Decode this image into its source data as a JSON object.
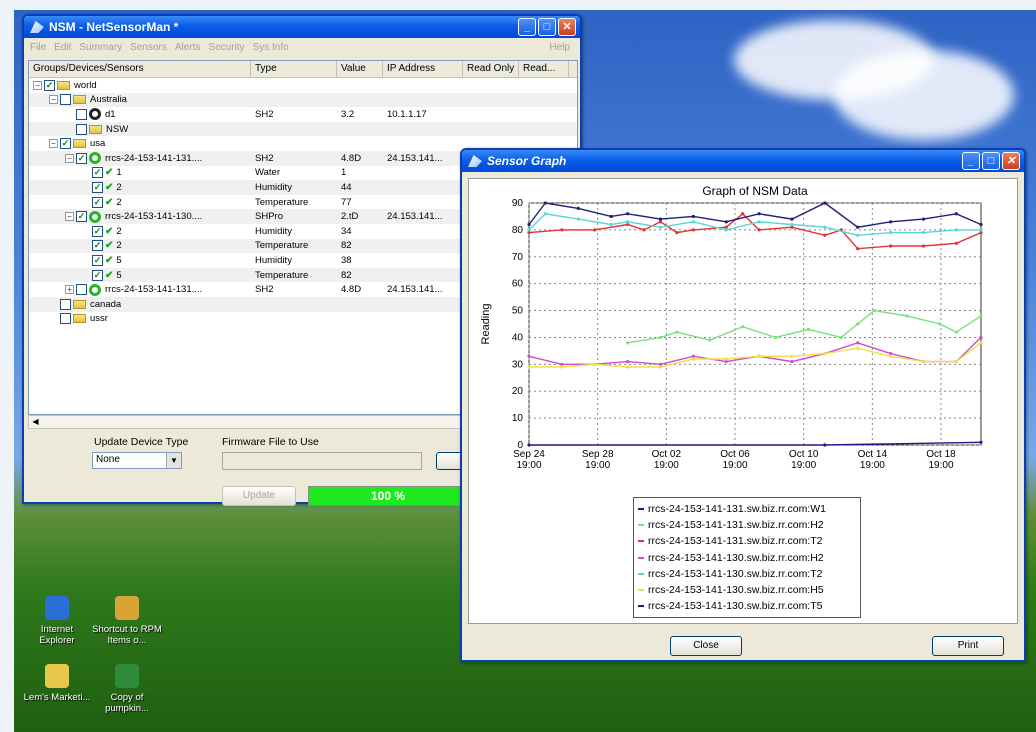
{
  "nsm_window": {
    "title": "NSM - NetSensorMan *",
    "menu": [
      "File",
      "Edit",
      "Summary",
      "Sensors",
      "Alerts",
      "Security",
      "Sys Info"
    ],
    "help": "Help",
    "columns": [
      "Groups/Devices/Sensors",
      "Type",
      "Value",
      "IP Address",
      "Read Only",
      "Read..."
    ],
    "tree": [
      {
        "level": 0,
        "expander": "−",
        "checked": true,
        "icon": "folder-icon",
        "name": "world",
        "type": "",
        "value": "",
        "ip": ""
      },
      {
        "level": 1,
        "expander": "−",
        "checked": false,
        "icon": "folder-icon",
        "name": "Australia",
        "type": "",
        "value": "",
        "ip": ""
      },
      {
        "level": 2,
        "expander": "",
        "checked": false,
        "icon": "device-offline-icon",
        "name": "d1",
        "type": "SH2",
        "value": "3.2",
        "ip": "10.1.1.17"
      },
      {
        "level": 2,
        "expander": "",
        "checked": false,
        "icon": "folder-icon",
        "name": "NSW",
        "type": "",
        "value": "",
        "ip": ""
      },
      {
        "level": 1,
        "expander": "−",
        "checked": true,
        "icon": "folder-icon",
        "name": "usa",
        "type": "",
        "value": "",
        "ip": ""
      },
      {
        "level": 2,
        "expander": "−",
        "checked": true,
        "icon": "device-online-icon",
        "name": "rrcs-24-153-141-131....",
        "type": "SH2",
        "value": "4.8D",
        "ip": "24.153.141..."
      },
      {
        "level": 3,
        "expander": "",
        "checked": true,
        "icon": "tick-icon",
        "name": "1",
        "type": "Water",
        "value": "1",
        "ip": ""
      },
      {
        "level": 3,
        "expander": "",
        "checked": true,
        "icon": "tick-icon",
        "name": "2",
        "type": "Humidity",
        "value": "44",
        "ip": ""
      },
      {
        "level": 3,
        "expander": "",
        "checked": true,
        "icon": "tick-icon",
        "name": "2",
        "type": "Temperature",
        "value": "77",
        "ip": ""
      },
      {
        "level": 2,
        "expander": "−",
        "checked": true,
        "icon": "device-online-icon",
        "name": "rrcs-24-153-141-130....",
        "type": "SHPro",
        "value": "2.tD",
        "ip": "24.153.141..."
      },
      {
        "level": 3,
        "expander": "",
        "checked": true,
        "icon": "tick-icon",
        "name": "2",
        "type": "Humidity",
        "value": "34",
        "ip": ""
      },
      {
        "level": 3,
        "expander": "",
        "checked": true,
        "icon": "tick-icon",
        "name": "2",
        "type": "Temperature",
        "value": "82",
        "ip": ""
      },
      {
        "level": 3,
        "expander": "",
        "checked": true,
        "icon": "tick-icon",
        "name": "5",
        "type": "Humidity",
        "value": "38",
        "ip": ""
      },
      {
        "level": 3,
        "expander": "",
        "checked": true,
        "icon": "tick-icon",
        "name": "5",
        "type": "Temperature",
        "value": "82",
        "ip": ""
      },
      {
        "level": 2,
        "expander": "+",
        "checked": false,
        "icon": "device-online-icon",
        "name": "rrcs-24-153-141-131....",
        "type": "SH2",
        "value": "4.8D",
        "ip": "24.153.141..."
      },
      {
        "level": 1,
        "expander": "",
        "checked": false,
        "icon": "folder-icon",
        "name": "canada",
        "type": "",
        "value": "",
        "ip": ""
      },
      {
        "level": 1,
        "expander": "",
        "checked": false,
        "icon": "folder-icon",
        "name": "ussr",
        "type": "",
        "value": "",
        "ip": ""
      }
    ],
    "update_device_type_label": "Update Device Type",
    "firmware_label": "Firmware File to Use",
    "device_type_value": "None",
    "update_button": "Update",
    "progress_text": "100 %",
    "progress_fraction": 1.0
  },
  "graph_window": {
    "title": "Sensor Graph",
    "close_button": "Close",
    "print_button": "Print"
  },
  "desktop_icons": [
    {
      "label": "Internet Explorer",
      "icon": "ie-icon",
      "color": "#2a6fd6"
    },
    {
      "label": "Shortcut to RPM Items o...",
      "icon": "shortcut-icon",
      "color": "#d8a43a"
    },
    {
      "label": "Lem's Marketi...",
      "icon": "folder-icon",
      "color": "#e8c84a"
    },
    {
      "label": "Copy of pumpkin...",
      "icon": "excel-icon",
      "color": "#2f8a3a"
    }
  ],
  "chart_data": {
    "type": "line",
    "title": "Graph of NSM Data",
    "xlabel": "",
    "ylabel": "Reading",
    "ylim": [
      0,
      90
    ],
    "yticks": [
      0,
      10,
      20,
      30,
      40,
      50,
      60,
      70,
      80,
      90
    ],
    "xticks": [
      "Sep 24\n19:00",
      "Sep 28\n19:00",
      "Oct 02\n19:00",
      "Oct 06\n19:00",
      "Oct 10\n19:00",
      "Oct 14\n19:00",
      "Oct 18\n19:00"
    ],
    "xlim_days": [
      0,
      27.5
    ],
    "grid": true,
    "legend": "bottom",
    "series": [
      {
        "name": "rrcs-24-153-141-131.sw.biz.rr.com:W1",
        "color": "#1a1a8c",
        "x": [
          0,
          18,
          27.5
        ],
        "y": [
          0,
          0,
          1
        ]
      },
      {
        "name": "rrcs-24-153-141-131.sw.biz.rr.com:H2",
        "color": "#7ae07a",
        "x": [
          6,
          8,
          9,
          11,
          13,
          15,
          17,
          19,
          20,
          21,
          23,
          25,
          26,
          27.5
        ],
        "y": [
          38,
          40,
          42,
          39,
          44,
          40,
          43,
          40,
          45,
          50,
          48,
          45,
          42,
          48
        ]
      },
      {
        "name": "rrcs-24-153-141-131.sw.biz.rr.com:T2",
        "color": "#e83030",
        "x": [
          0,
          2,
          4,
          6,
          7,
          8,
          9,
          10,
          12,
          13,
          14,
          16,
          18,
          19,
          20,
          22,
          24,
          26,
          27.5
        ],
        "y": [
          79,
          80,
          80,
          82,
          80,
          83,
          79,
          80,
          81,
          86,
          80,
          81,
          78,
          80,
          73,
          74,
          74,
          75,
          79
        ]
      },
      {
        "name": "rrcs-24-153-141-130.sw.biz.rr.com:H2",
        "color": "#d04ad0",
        "x": [
          0,
          2,
          4,
          6,
          8,
          10,
          12,
          14,
          16,
          18,
          20,
          22,
          24,
          26,
          27.5
        ],
        "y": [
          33,
          30,
          30,
          31,
          30,
          33,
          31,
          33,
          31,
          34,
          38,
          34,
          31,
          31,
          40
        ]
      },
      {
        "name": "rrcs-24-153-141-130.sw.biz.rr.com:T2",
        "color": "#5ad6d6",
        "x": [
          0,
          1,
          3,
          5,
          6,
          8,
          10,
          12,
          14,
          16,
          18,
          20,
          22,
          24,
          26,
          27.5
        ],
        "y": [
          80,
          86,
          84,
          82,
          83,
          81,
          83,
          80,
          83,
          82,
          81,
          78,
          79,
          79,
          80,
          80
        ]
      },
      {
        "name": "rrcs-24-153-141-130.sw.biz.rr.com:H5",
        "color": "#f0e040",
        "x": [
          0,
          2,
          4,
          6,
          8,
          10,
          12,
          14,
          16,
          18,
          20,
          22,
          24,
          26,
          27.5
        ],
        "y": [
          29,
          29,
          30,
          29,
          29,
          32,
          32,
          33,
          33,
          34,
          36,
          33,
          31,
          31,
          38
        ]
      },
      {
        "name": "rrcs-24-153-141-130.sw.biz.rr.com:T5",
        "color": "#20207a",
        "x": [
          0,
          1,
          3,
          5,
          6,
          8,
          10,
          12,
          14,
          16,
          18,
          20,
          22,
          24,
          26,
          27.5
        ],
        "y": [
          82,
          90,
          88,
          85,
          86,
          84,
          85,
          83,
          86,
          84,
          90,
          81,
          83,
          84,
          86,
          82
        ]
      }
    ]
  }
}
